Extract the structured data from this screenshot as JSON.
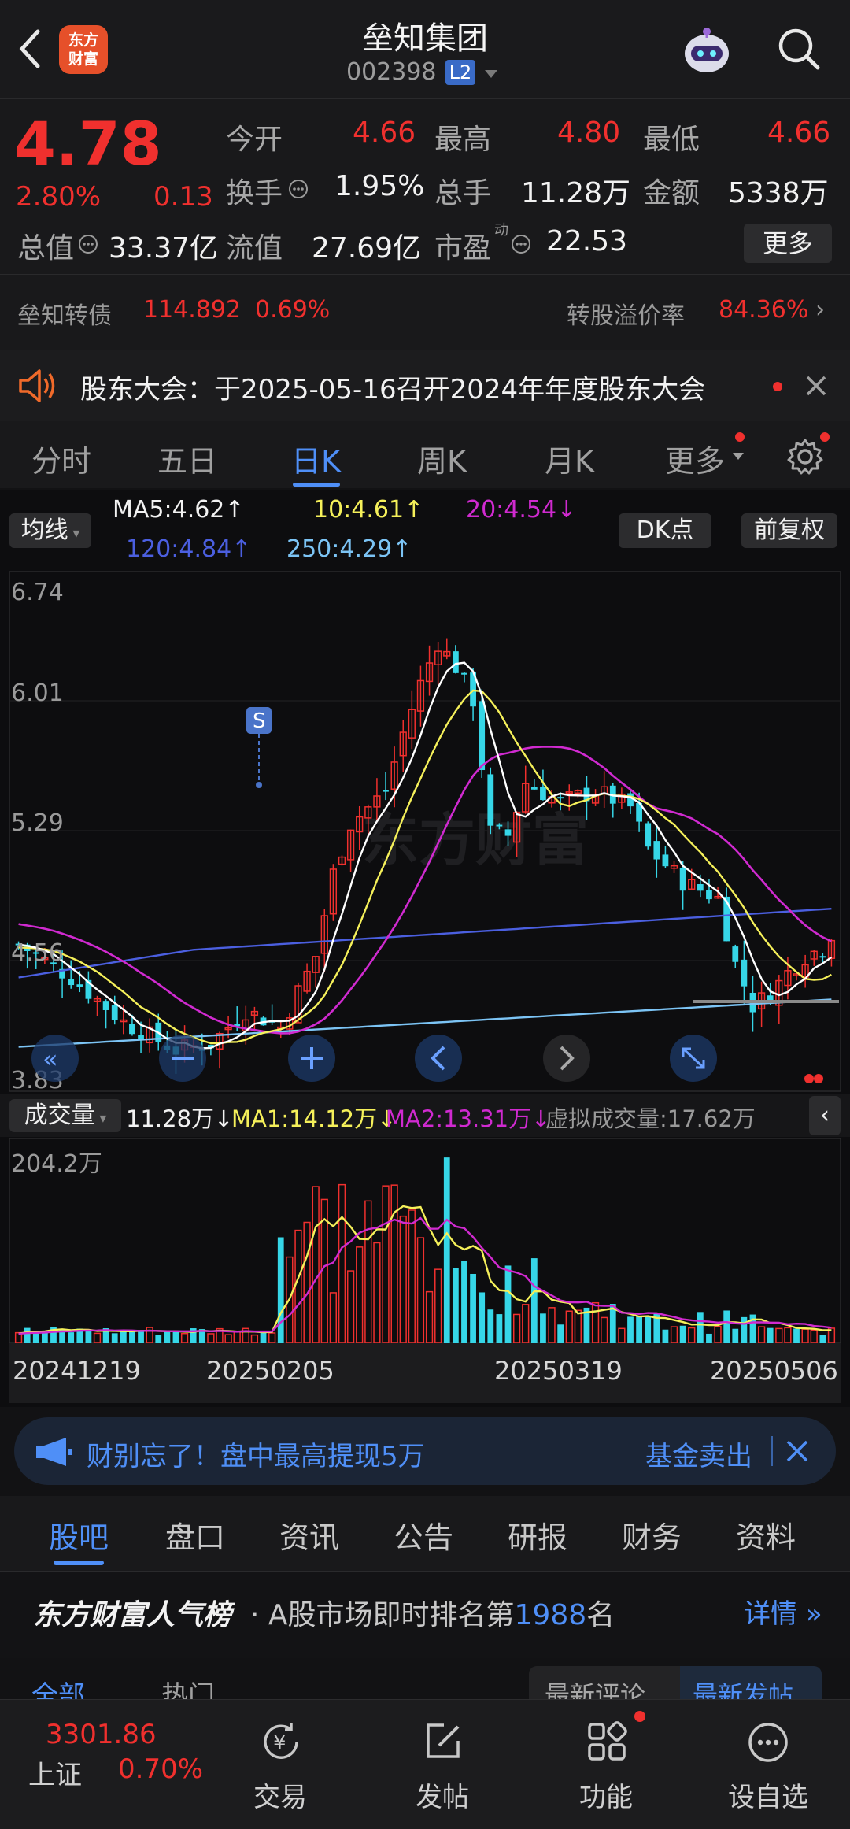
{
  "header": {
    "logo_text_1": "东方",
    "logo_text_2": "财富",
    "title": "垒知集团",
    "code": "002398",
    "level_badge": "L2"
  },
  "quote": {
    "price": "4.78",
    "change_pct": "2.80%",
    "change_amt": "0.13",
    "open_label": "今开",
    "open": "4.66",
    "high_label": "最高",
    "high": "4.80",
    "low_label": "最低",
    "low": "4.66",
    "turnover_label": "换手",
    "turnover": "1.95%",
    "volume_label": "总手",
    "volume": "11.28万",
    "amount_label": "金额",
    "amount": "5338万",
    "mcap_label": "总值",
    "mcap": "33.37亿",
    "float_label": "流值",
    "float_mcap": "27.69亿",
    "pe_label": "市盈",
    "pe_sup": "动",
    "pe": "22.53",
    "more_button": "更多"
  },
  "bond": {
    "name": "垒知转债",
    "price": "114.892",
    "pct": "0.69%",
    "premium_label": "转股溢价率",
    "premium": "84.36%"
  },
  "notice": {
    "text": "股东大会：于2025-05-16召开2024年年度股东大会"
  },
  "ktabs": [
    "分时",
    "五日",
    "日K",
    "周K",
    "月K",
    "更多"
  ],
  "ma": {
    "selector": "均线",
    "ma5": "MA5:4.62↑",
    "ma10": "10:4.61↑",
    "ma20": "20:4.54↓",
    "ma120": "120:4.84↑",
    "ma250": "250:4.29↑",
    "dk_button": "DK点",
    "adjust_button": "前复权"
  },
  "price_axis": [
    "6.74",
    "6.01",
    "5.29",
    "4.56",
    "3.83"
  ],
  "signal_marker": "S",
  "volume": {
    "selector": "成交量",
    "current": "11.28万↓",
    "ma1": "MA1:14.12万↓",
    "ma2": "MA2:13.31万↓",
    "virtual": "虚拟成交量:17.62万",
    "max_label": "204.2万"
  },
  "date_axis": [
    "20241219",
    "20250205",
    "20250319",
    "20250506"
  ],
  "banner": {
    "text": "财别忘了！盘中最高提现5万",
    "right": "基金卖出"
  },
  "btabs": [
    "股吧",
    "盘口",
    "资讯",
    "公告",
    "研报",
    "财务",
    "资料"
  ],
  "rank": {
    "brand": "东方财富人气榜",
    "text_pre": "· A股市场即时排名第",
    "rank_num": "1988",
    "text_post": "名",
    "detail": "详情"
  },
  "subtabs": [
    "全部",
    "热门",
    "最新评论",
    "最新发帖"
  ],
  "index": {
    "value": "3301.86",
    "name": "上证",
    "pct": "0.70%"
  },
  "nav": [
    "交易",
    "发帖",
    "功能",
    "设自选"
  ],
  "colors": {
    "up": "#f0302e",
    "down": "#36d6e7",
    "ma5": "#ffffff",
    "ma10": "#f5f05a",
    "ma20": "#d02ad0",
    "ma120": "#4b5fe0",
    "ma250": "#7cc4f5"
  }
}
